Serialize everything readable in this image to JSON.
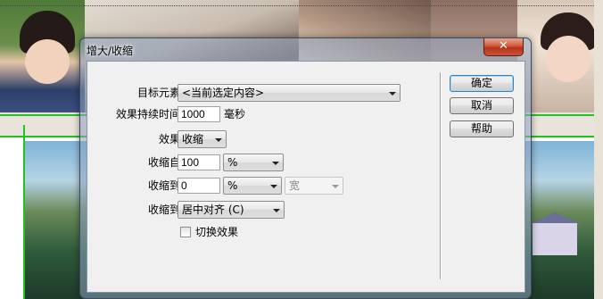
{
  "dialog": {
    "title": "增大/收缩",
    "close_glyph": "✕",
    "target_label": "目标元素:",
    "target_value": "<当前选定内容>",
    "duration_label": "效果持续时间:",
    "duration_value": "1000",
    "duration_unit": "毫秒",
    "effect_label": "效果:",
    "effect_value": "收缩",
    "from_label": "收缩自:",
    "from_value": "100",
    "from_unit": "%",
    "to_label": "收缩到:",
    "to_value": "0",
    "to_unit": "%",
    "to_dimension": "宽",
    "align_label": "收缩到:",
    "align_value": "居中对齐 (C)",
    "toggle_label": "切换效果",
    "toggle_checked": false,
    "buttons": {
      "ok": "确定",
      "cancel": "取消",
      "help": "帮助"
    }
  },
  "colors": {
    "guide": "#22c222",
    "close_button": "#c9432a",
    "dialog_frame": "#8ca0be"
  },
  "icons": {
    "close": "close-icon",
    "dropdown": "chevron-down-icon",
    "checkbox": "checkbox-icon"
  }
}
